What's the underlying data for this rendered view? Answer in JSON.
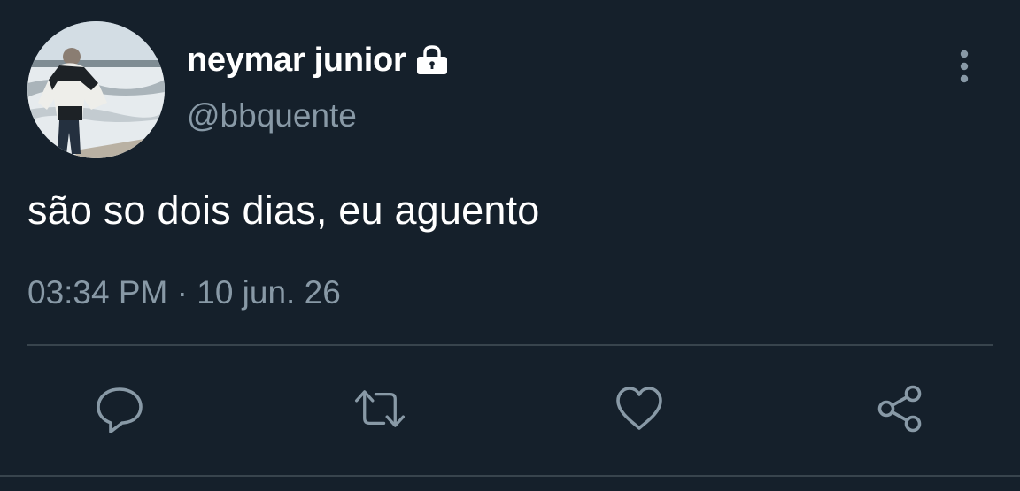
{
  "user": {
    "display_name": "neymar junior",
    "handle": "@bbquente",
    "protected_icon": "lock-icon",
    "avatar": "profile-avatar"
  },
  "tweet": {
    "text": "são so dois dias, eu aguento",
    "timestamp": "03:34 PM · 10 jun. 26"
  },
  "actions": {
    "reply_icon": "reply-icon",
    "retweet_icon": "retweet-icon",
    "like_icon": "heart-icon",
    "share_icon": "share-icon"
  },
  "menu": {
    "more_icon": "more-vertical-icon"
  },
  "colors": {
    "background": "#15202b",
    "primary_text": "#ffffff",
    "secondary_text": "#8899a6",
    "divider": "#38444d"
  }
}
